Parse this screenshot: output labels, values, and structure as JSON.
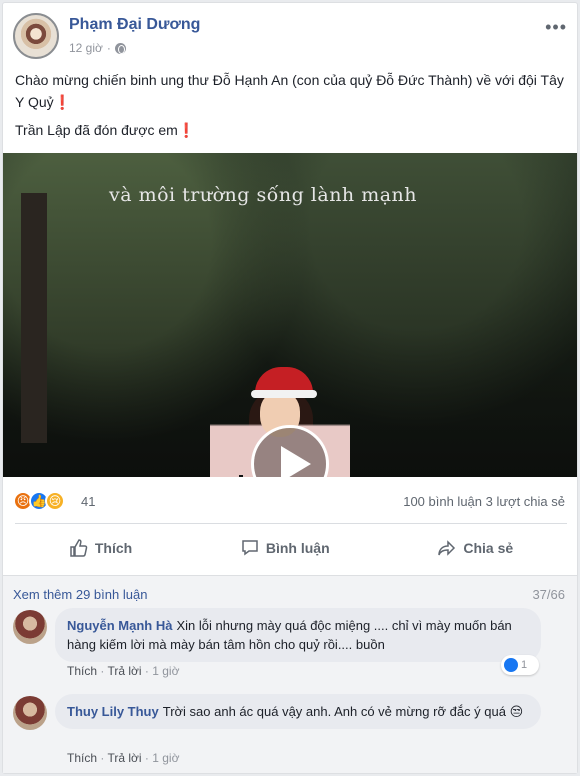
{
  "post": {
    "author": "Phạm Đại Dương",
    "time": "12 giờ",
    "text_line_1": "Chào mừng chiến binh ung thư Đỗ Hạnh An (con của quỷ Đỗ Đức Thành) về với đội Tây Y Quỷ",
    "text_line_2": "Trần Lập đã đón được em",
    "exclamation": "❗",
    "video_caption": "và môi trường sống lành mạnh"
  },
  "stats": {
    "reaction_count": "41",
    "comment_share": "100 bình luận  3 lượt chia sẻ",
    "reactions": [
      "angry-icon",
      "like-icon",
      "sad-icon"
    ]
  },
  "actions": {
    "like": "Thích",
    "comment": "Bình luận",
    "share": "Chia sẻ"
  },
  "comments": {
    "more_label": "Xem thêm 29 bình luận",
    "pager": "37/66",
    "items": [
      {
        "name": "Nguyễn Mạnh Hà",
        "text": "Xin lỗi nhưng mày quá độc miệng .... chỉ vì mày muốn bán hàng kiếm lời mà mày bán tâm hồn cho quỷ rồi.... buồn",
        "like": "Thích",
        "reply": "Trả lời",
        "time": "1 giờ",
        "likes": "1"
      },
      {
        "name": "Thuy Lily Thuy",
        "text": "Trời sao anh ác quá vậy anh. Anh có vẻ mừng rỡ đắc ý quá",
        "emoji": "😒",
        "like": "Thích",
        "reply": "Trả lời",
        "time": "1 giờ"
      }
    ]
  }
}
